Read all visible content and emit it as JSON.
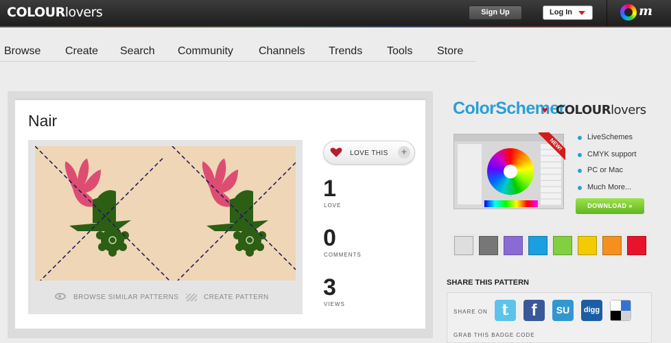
{
  "header": {
    "logo_bold": "COLOUR",
    "logo_light": "lovers",
    "signup": "Sign Up",
    "login": "Log In",
    "brand_mark": "m"
  },
  "nav": [
    "Browse",
    "Create",
    "Search",
    "Community",
    "Channels",
    "Trends",
    "Tools",
    "Store"
  ],
  "pattern": {
    "title": "Nair",
    "background_color": "#efd6b6",
    "motif_colors": [
      "#dd4d72",
      "#2c5e14",
      "#1c1c5c"
    ],
    "browse_similar": "BROWSE SIMILAR PATTERNS",
    "create": "CREATE PATTERN",
    "love_button": "LOVE THIS",
    "plus": "+",
    "stats": [
      {
        "value": "1",
        "label": "LOVE"
      },
      {
        "value": "0",
        "label": "COMMENTS"
      },
      {
        "value": "3",
        "label": "VIEWS"
      }
    ]
  },
  "sidebar": {
    "cs_title": "ColorSchemer",
    "cs_partner_bold": "COLOUR",
    "cs_partner_light": "lovers",
    "new_tag": "NEW!",
    "features": [
      "LiveSchemes",
      "CMYK support",
      "PC or Mac",
      "Much More..."
    ],
    "download": "DOWNLOAD »",
    "swatches": [
      "#dedede",
      "#777777",
      "#8a6bd6",
      "#1a9fe0",
      "#80d040",
      "#f2cc00",
      "#f5901e",
      "#e8142c"
    ],
    "share_heading": "SHARE THIS PATTERN",
    "share_on": "SHARE ON",
    "social": [
      {
        "name": "twitter",
        "glyph": "t",
        "color": "#5dc3ea"
      },
      {
        "name": "facebook",
        "glyph": "f",
        "color": "#3b5998"
      },
      {
        "name": "stumbleupon",
        "glyph": "SU",
        "color": "#3397cf"
      },
      {
        "name": "digg",
        "glyph": "digg",
        "color": "#1c5ea4"
      },
      {
        "name": "delicious",
        "glyph": "",
        "color": "#ffffff"
      }
    ],
    "grab_code": "GRAB THIS BADGE CODE"
  }
}
